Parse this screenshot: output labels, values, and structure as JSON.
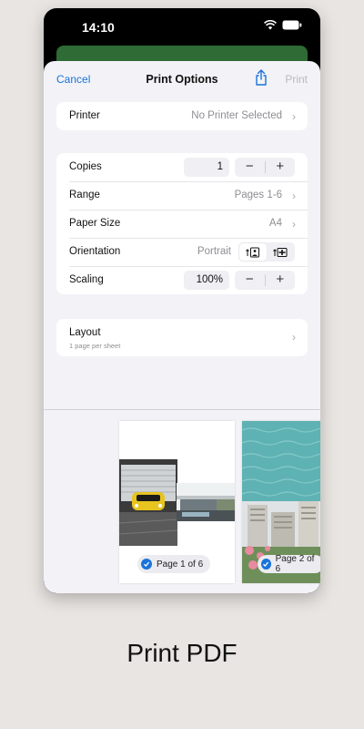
{
  "status_bar": {
    "time": "14:10"
  },
  "nav": {
    "cancel_label": "Cancel",
    "title": "Print Options",
    "print_label": "Print"
  },
  "printer": {
    "label": "Printer",
    "value": "No Printer Selected"
  },
  "options": {
    "copies": {
      "label": "Copies",
      "value": "1"
    },
    "range": {
      "label": "Range",
      "value": "Pages 1-6"
    },
    "paper_size": {
      "label": "Paper Size",
      "value": "A4"
    },
    "orientation": {
      "label": "Orientation",
      "value": "Portrait"
    },
    "scaling": {
      "label": "Scaling",
      "value": "100%"
    }
  },
  "layout": {
    "label": "Layout",
    "subtitle": "1 page per sheet"
  },
  "previews": [
    {
      "label": "Page 1 of 6"
    },
    {
      "label": "Page 2 of 6"
    }
  ],
  "caption": "Print PDF",
  "colors": {
    "accent": "#1a73d9",
    "sheet_bg": "#f2f2f7",
    "page_bg": "#e9e5e2",
    "header_green": "#2f6b34"
  }
}
